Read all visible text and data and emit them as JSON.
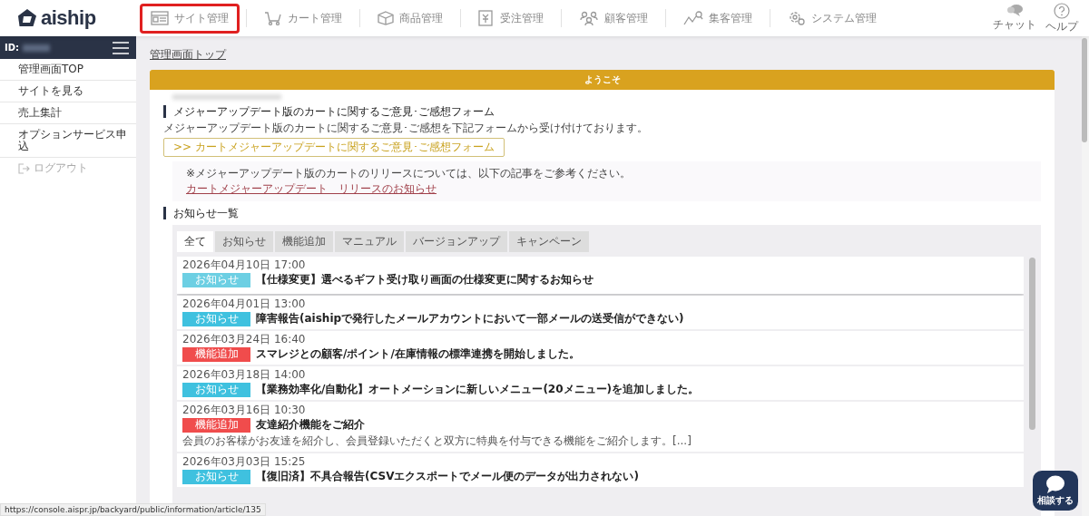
{
  "header": {
    "logo": "aiship",
    "nav": [
      {
        "label": "サイト管理",
        "highlighted": true
      },
      {
        "label": "カート管理",
        "highlighted": false
      },
      {
        "label": "商品管理",
        "highlighted": false
      },
      {
        "label": "受注管理",
        "highlighted": false
      },
      {
        "label": "顧客管理",
        "highlighted": false
      },
      {
        "label": "集客管理",
        "highlighted": false
      },
      {
        "label": "システム管理",
        "highlighted": false
      }
    ],
    "tools": [
      {
        "label": "チャット"
      },
      {
        "label": "ヘルプ"
      }
    ]
  },
  "sidebar": {
    "id_label": "ID:",
    "items": [
      {
        "label": "管理画面TOP",
        "kind": "link"
      },
      {
        "label": "サイトを見る",
        "kind": "link"
      },
      {
        "label": "売上集計",
        "kind": "link"
      },
      {
        "label": "オプションサービス申込",
        "kind": "link"
      },
      {
        "label": "ログアウト",
        "kind": "logout"
      }
    ]
  },
  "breadcrumb": "管理画面トップ",
  "welcome": {
    "title": "ようこそ",
    "feedback": {
      "heading": "メジャーアップデート版のカートに関するご意見･ご感想フォーム",
      "text": "メジャーアップデート版のカートに関するご意見･ご感想を下記フォームから受け付けております。",
      "button": ">> カートメジャーアップデートに関するご意見･ご感想フォーム"
    },
    "note": {
      "text": "※メジャーアップデート版のカートのリリースについては、以下の記事をご参考ください。",
      "link": "カートメジャーアップデート　リリースのお知らせ"
    },
    "news": {
      "heading": "お知らせ一覧",
      "tabs": [
        {
          "label": "全て",
          "selected": true
        },
        {
          "label": "お知らせ",
          "selected": false
        },
        {
          "label": "機能追加",
          "selected": false
        },
        {
          "label": "マニュアル",
          "selected": false
        },
        {
          "label": "バージョンアップ",
          "selected": false
        },
        {
          "label": "キャンペーン",
          "selected": false
        }
      ],
      "items": [
        {
          "date": "2026年04月10日 17:00",
          "tag": "お知らせ",
          "color": "#6ccfe3",
          "title": "【仕様変更】選べるギフト受け取り画面の仕様変更に関するお知らせ",
          "hovered": true
        },
        {
          "date": "2026年04月01日 13:00",
          "tag": "お知らせ",
          "color": "#3fc1df",
          "title": "障害報告(aishipで発行したメールアカウントにおいて一部メールの送受信ができない)",
          "hovered": false
        },
        {
          "date": "2026年03月24日 16:40",
          "tag": "機能追加",
          "color": "#f04c4c",
          "title": "スマレジとの顧客/ポイント/在庫情報の標準連携を開始しました。",
          "hovered": false
        },
        {
          "date": "2026年03月18日 14:00",
          "tag": "お知らせ",
          "color": "#3fc1df",
          "title": "【業務効率化/自動化】オートメーションに新しいメニュー(20メニュー)を追加しました。",
          "hovered": false
        },
        {
          "date": "2026年03月16日 10:30",
          "tag": "機能追加",
          "color": "#f04c4c",
          "title": "友達紹介機能をご紹介",
          "summary": "会員のお客様がお友達を紹介し、会員登録いただくと双方に特典を付与できる機能をご紹介します。[...]",
          "hovered": false
        },
        {
          "date": "2026年03月03日 15:25",
          "tag": "お知らせ",
          "color": "#3fc1df",
          "title": "【復旧済】不具合報告(CSVエクスポートでメール便のデータが出力されない)",
          "hovered": false
        }
      ]
    }
  },
  "consult_button": "相談する",
  "status_bar": "https://console.aispr.jp/backyard/public/information/article/135"
}
